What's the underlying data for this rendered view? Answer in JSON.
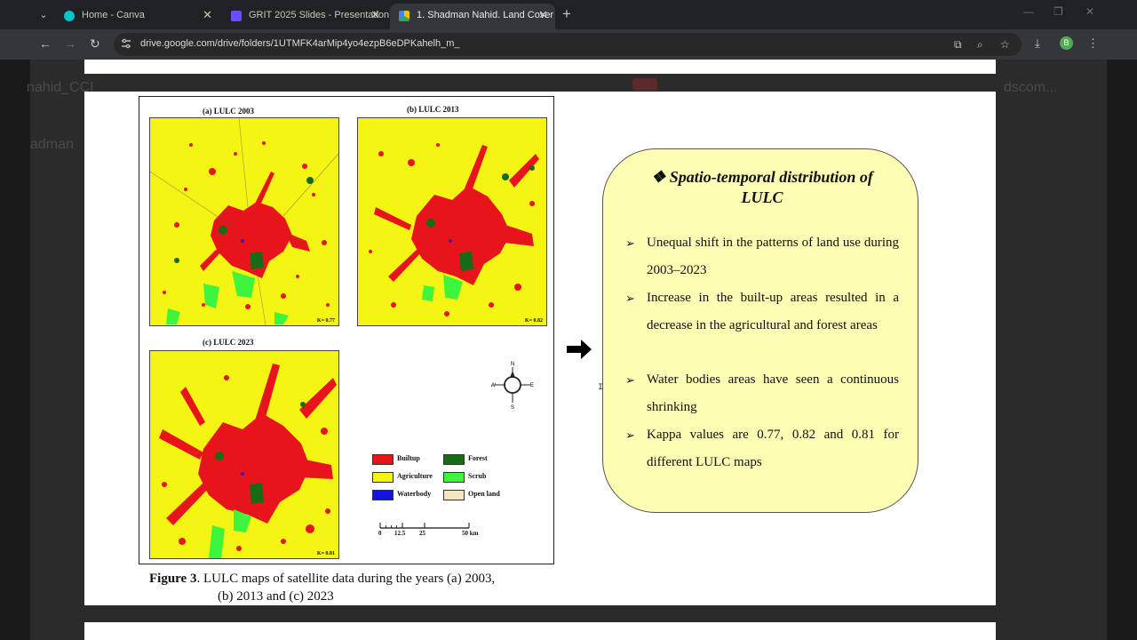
{
  "browser": {
    "tabs": [
      {
        "title": "Home - Canva",
        "active": false,
        "favicon_color": "#00c4cc"
      },
      {
        "title": "GRIT 2025 Slides - Presentation",
        "active": false,
        "favicon_color": "#6b4cff"
      },
      {
        "title": "1. Shadman Nahid. Land Cover",
        "active": true,
        "favicon_color": "#fbbc04"
      }
    ],
    "url": "drive.google.com/drive/folders/1UTMFK4arMip4yo4ezpB6eDPKahelh_m_",
    "avatar_letter": "B"
  },
  "background_text": {
    "left_title": "nahid_CCI",
    "left_sub": "adman",
    "right_title": "dscom..."
  },
  "figure": {
    "map_a_label": "(a)  LULC 2003",
    "map_b_label": "(b)  LULC 2013",
    "map_c_label": "(c)  LULC 2023",
    "kappa_a": "K= 0.77",
    "kappa_b": "K= 0.82",
    "kappa_c": "K= 0.81",
    "compass": {
      "n": "N",
      "s": "S",
      "e": "E",
      "w": "W"
    },
    "legend": [
      {
        "label": "Builtup",
        "color": "#e8141c"
      },
      {
        "label": "Forest",
        "color": "#166b16"
      },
      {
        "label": "Agriculture",
        "color": "#f5f514"
      },
      {
        "label": "Scrub",
        "color": "#3ef53e"
      },
      {
        "label": "Waterbody",
        "color": "#1414e0"
      },
      {
        "label": "Open land",
        "color": "#f3e6c0"
      }
    ],
    "scale": {
      "t0": "0",
      "t1": "12.5",
      "t2": "25",
      "t3": "50 km"
    },
    "caption_bold": "Figure 3",
    "caption_line1": ". LULC maps of satellite data during the years (a) 2003,",
    "caption_line2": "(b) 2013 and (c) 2023"
  },
  "infobox": {
    "title_symbol": "❖",
    "title": "Spatio-temporal distribution of LULC",
    "bullet_symbol": "➢",
    "bullets": [
      "Unequal shift in the patterns of land use during 2003–2023",
      "Increase in the built-up areas resulted in a decrease in the agricultural and forest areas",
      "Water bodies areas have seen a continuous shrinking",
      "Kappa values are 0.77, 0.82 and 0.81 for different LULC maps"
    ]
  },
  "colors": {
    "builtup": "#e8141c",
    "agriculture": "#f5f514",
    "forest": "#166b16",
    "scrub": "#3ef53e",
    "waterbody": "#1414e0",
    "infobox_bg": "#fefdb4"
  }
}
